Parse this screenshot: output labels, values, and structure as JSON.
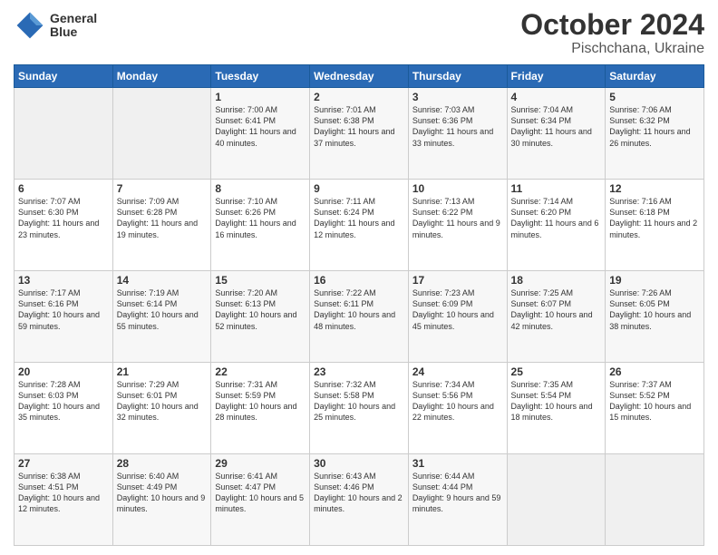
{
  "header": {
    "logo_line1": "General",
    "logo_line2": "Blue",
    "title": "October 2024",
    "subtitle": "Pischchana, Ukraine"
  },
  "days_of_week": [
    "Sunday",
    "Monday",
    "Tuesday",
    "Wednesday",
    "Thursday",
    "Friday",
    "Saturday"
  ],
  "weeks": [
    [
      {
        "day": "",
        "empty": true
      },
      {
        "day": "",
        "empty": true
      },
      {
        "day": "1",
        "sunrise": "7:00 AM",
        "sunset": "6:41 PM",
        "daylight": "11 hours and 40 minutes."
      },
      {
        "day": "2",
        "sunrise": "7:01 AM",
        "sunset": "6:38 PM",
        "daylight": "11 hours and 37 minutes."
      },
      {
        "day": "3",
        "sunrise": "7:03 AM",
        "sunset": "6:36 PM",
        "daylight": "11 hours and 33 minutes."
      },
      {
        "day": "4",
        "sunrise": "7:04 AM",
        "sunset": "6:34 PM",
        "daylight": "11 hours and 30 minutes."
      },
      {
        "day": "5",
        "sunrise": "7:06 AM",
        "sunset": "6:32 PM",
        "daylight": "11 hours and 26 minutes."
      }
    ],
    [
      {
        "day": "6",
        "sunrise": "7:07 AM",
        "sunset": "6:30 PM",
        "daylight": "11 hours and 23 minutes."
      },
      {
        "day": "7",
        "sunrise": "7:09 AM",
        "sunset": "6:28 PM",
        "daylight": "11 hours and 19 minutes."
      },
      {
        "day": "8",
        "sunrise": "7:10 AM",
        "sunset": "6:26 PM",
        "daylight": "11 hours and 16 minutes."
      },
      {
        "day": "9",
        "sunrise": "7:11 AM",
        "sunset": "6:24 PM",
        "daylight": "11 hours and 12 minutes."
      },
      {
        "day": "10",
        "sunrise": "7:13 AM",
        "sunset": "6:22 PM",
        "daylight": "11 hours and 9 minutes."
      },
      {
        "day": "11",
        "sunrise": "7:14 AM",
        "sunset": "6:20 PM",
        "daylight": "11 hours and 6 minutes."
      },
      {
        "day": "12",
        "sunrise": "7:16 AM",
        "sunset": "6:18 PM",
        "daylight": "11 hours and 2 minutes."
      }
    ],
    [
      {
        "day": "13",
        "sunrise": "7:17 AM",
        "sunset": "6:16 PM",
        "daylight": "10 hours and 59 minutes."
      },
      {
        "day": "14",
        "sunrise": "7:19 AM",
        "sunset": "6:14 PM",
        "daylight": "10 hours and 55 minutes."
      },
      {
        "day": "15",
        "sunrise": "7:20 AM",
        "sunset": "6:13 PM",
        "daylight": "10 hours and 52 minutes."
      },
      {
        "day": "16",
        "sunrise": "7:22 AM",
        "sunset": "6:11 PM",
        "daylight": "10 hours and 48 minutes."
      },
      {
        "day": "17",
        "sunrise": "7:23 AM",
        "sunset": "6:09 PM",
        "daylight": "10 hours and 45 minutes."
      },
      {
        "day": "18",
        "sunrise": "7:25 AM",
        "sunset": "6:07 PM",
        "daylight": "10 hours and 42 minutes."
      },
      {
        "day": "19",
        "sunrise": "7:26 AM",
        "sunset": "6:05 PM",
        "daylight": "10 hours and 38 minutes."
      }
    ],
    [
      {
        "day": "20",
        "sunrise": "7:28 AM",
        "sunset": "6:03 PM",
        "daylight": "10 hours and 35 minutes."
      },
      {
        "day": "21",
        "sunrise": "7:29 AM",
        "sunset": "6:01 PM",
        "daylight": "10 hours and 32 minutes."
      },
      {
        "day": "22",
        "sunrise": "7:31 AM",
        "sunset": "5:59 PM",
        "daylight": "10 hours and 28 minutes."
      },
      {
        "day": "23",
        "sunrise": "7:32 AM",
        "sunset": "5:58 PM",
        "daylight": "10 hours and 25 minutes."
      },
      {
        "day": "24",
        "sunrise": "7:34 AM",
        "sunset": "5:56 PM",
        "daylight": "10 hours and 22 minutes."
      },
      {
        "day": "25",
        "sunrise": "7:35 AM",
        "sunset": "5:54 PM",
        "daylight": "10 hours and 18 minutes."
      },
      {
        "day": "26",
        "sunrise": "7:37 AM",
        "sunset": "5:52 PM",
        "daylight": "10 hours and 15 minutes."
      }
    ],
    [
      {
        "day": "27",
        "sunrise": "6:38 AM",
        "sunset": "4:51 PM",
        "daylight": "10 hours and 12 minutes."
      },
      {
        "day": "28",
        "sunrise": "6:40 AM",
        "sunset": "4:49 PM",
        "daylight": "10 hours and 9 minutes."
      },
      {
        "day": "29",
        "sunrise": "6:41 AM",
        "sunset": "4:47 PM",
        "daylight": "10 hours and 5 minutes."
      },
      {
        "day": "30",
        "sunrise": "6:43 AM",
        "sunset": "4:46 PM",
        "daylight": "10 hours and 2 minutes."
      },
      {
        "day": "31",
        "sunrise": "6:44 AM",
        "sunset": "4:44 PM",
        "daylight": "9 hours and 59 minutes."
      },
      {
        "day": "",
        "empty": true
      },
      {
        "day": "",
        "empty": true
      }
    ]
  ]
}
